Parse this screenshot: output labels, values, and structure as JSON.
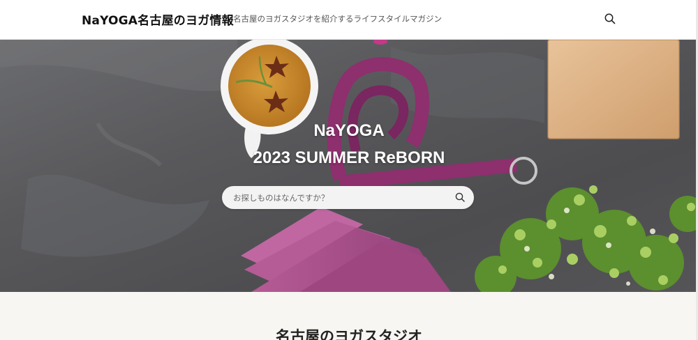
{
  "header": {
    "site_title": "NaYOGA名古屋のヨガ情報",
    "tagline": "名古屋のヨガスタジオを紹介するライフスタイルマガジン",
    "search_icon": "search-icon"
  },
  "hero": {
    "title_line1": "NaYOGA",
    "title_line2": "2023 SUMMER ReBORN",
    "search": {
      "placeholder": "お探しものはなんですか？",
      "value": "",
      "submit_icon": "search-icon"
    },
    "image_icon": "yoga-props-photo"
  },
  "main": {
    "section_heading": "名古屋のヨガスタジオ"
  },
  "colors": {
    "header_bg": "#ffffff",
    "section_bg": "#f7f6f2",
    "hero_text": "#ffffff",
    "strap": "#8e2f6e",
    "mat": "#a14a85"
  }
}
